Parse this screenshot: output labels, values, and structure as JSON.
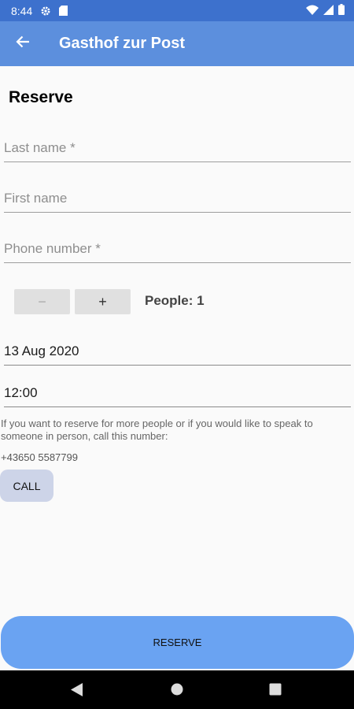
{
  "status_bar": {
    "time": "8:44",
    "icons": [
      "gear-icon",
      "sd-card-icon",
      "wifi-icon",
      "signal-icon",
      "battery-icon"
    ]
  },
  "app_bar": {
    "back_icon": "arrow-left-icon",
    "title": "Gasthof zur Post"
  },
  "form": {
    "heading": "Reserve",
    "last_name_placeholder": "Last name *",
    "first_name_placeholder": "First name",
    "phone_placeholder": "Phone number *",
    "minus_label": "−",
    "plus_label": "+",
    "people_label": "People: 1",
    "date_value": "13 Aug 2020",
    "time_value": "12:00"
  },
  "info": {
    "text": "If you want to reserve for more people or if you would like to speak to someone in person, call this number:",
    "phone": "+43650 5587799",
    "call_label": "CALL"
  },
  "reserve_label": "RESERVE",
  "colors": {
    "status_bar": "#3d71cd",
    "app_bar": "#5c8fdd",
    "reserve_button": "#6aa3f2",
    "call_button": "#cdd4e8"
  }
}
